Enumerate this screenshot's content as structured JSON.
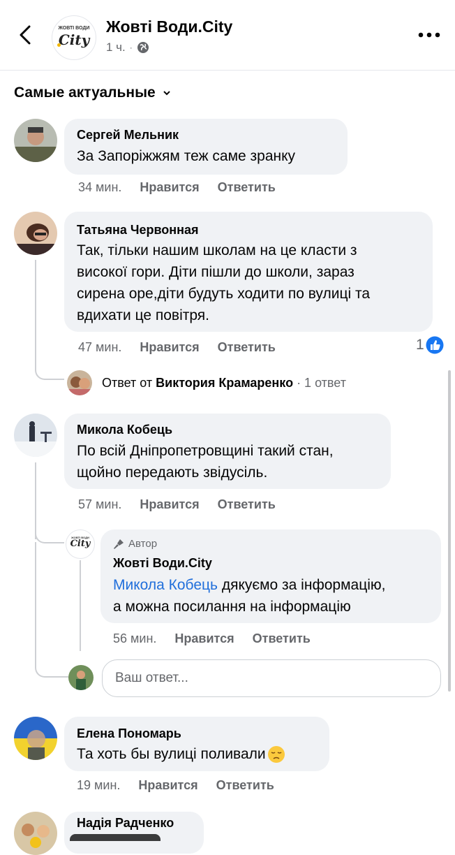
{
  "header": {
    "page_name": "Жовті Води.City",
    "time": "1 ч.",
    "logo_text_top": "ЖОВТІ ВОДИ",
    "logo_text_main": "City"
  },
  "sort_label": "Самые актуальные",
  "comments": [
    {
      "author": "Сергей Мельник",
      "text": "За Запоріжжям теж саме зранку",
      "time": "34 мин.",
      "like": "Нравится",
      "reply": "Ответить"
    },
    {
      "author": "Татьяна Червонная",
      "lines": [
        "Так, тільки нашим школам на це класти з",
        "високої гори. Діти пішли до школи, зараз",
        "сирена оре,діти будуть ходити по вулиці та",
        "вдихати це повітря."
      ],
      "time": "47 мин.",
      "like": "Нравится",
      "reply": "Ответить",
      "reactions": "1",
      "replies_prefix": "Ответ от",
      "replies_author": "Виктория Крамаренко",
      "replies_count": "· 1 ответ"
    },
    {
      "author": "Микола Кобець",
      "lines": [
        "По всій Дніпропетровщині такий стан,",
        "щойно передають звідусіль."
      ],
      "time": "57 мин.",
      "like": "Нравится",
      "reply": "Ответить"
    },
    {
      "author": "Елена Пономарь",
      "text": "Та хоть бы вулиці поливали",
      "time": "19 мин.",
      "like": "Нравится",
      "reply": "Ответить"
    },
    {
      "author": "Надія Радченко"
    }
  ],
  "author_reply": {
    "badge": "Автор",
    "author": "Жовті Води.City",
    "mention": "Микола Кобець",
    "line1_rest": " дякуємо за інформацію,",
    "line2": "а можна посилання на інформацію",
    "time": "56 мин.",
    "like": "Нравится",
    "reply": "Ответить"
  },
  "reply_input": {
    "placeholder": "Ваш ответ..."
  },
  "colors": {
    "bubble": "#f0f2f5",
    "secondary_text": "#65676b",
    "link": "#216fdb",
    "like_blue": "#1877f2"
  }
}
